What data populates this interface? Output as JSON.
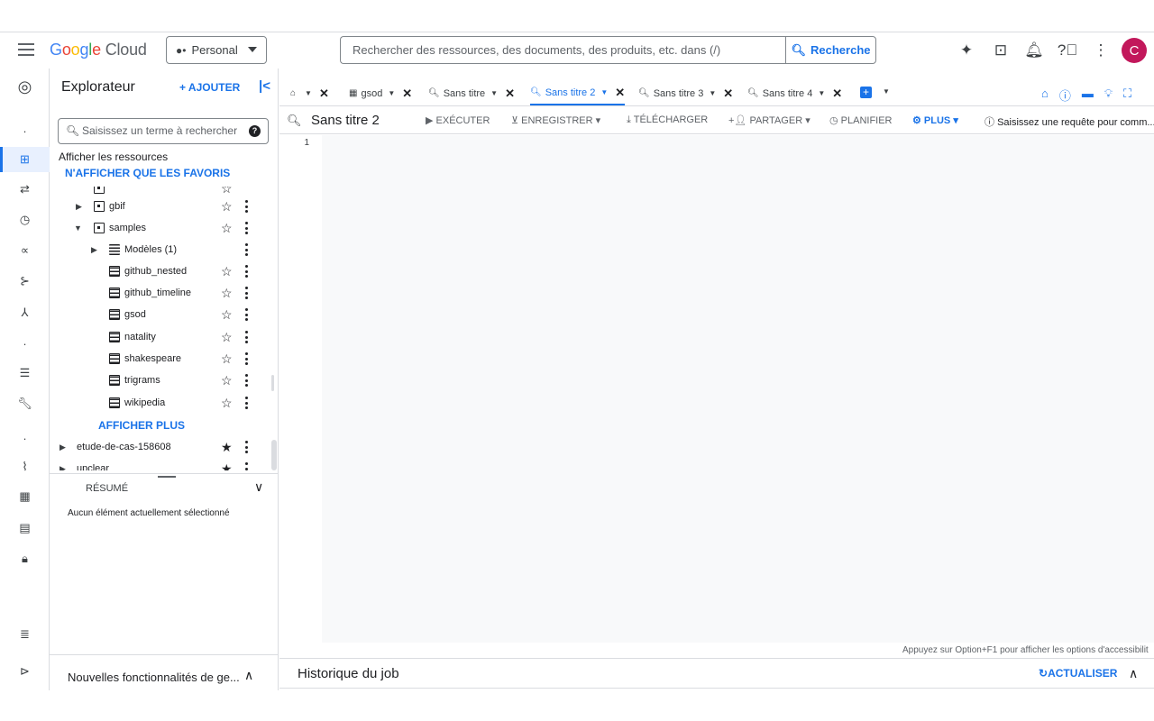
{
  "header": {
    "logo_google": [
      "G",
      "o",
      "o",
      "g",
      "l",
      "e"
    ],
    "logo_cloud": "Cloud",
    "project": "Personal",
    "search_placeholder": "Rechercher des ressources, des documents, des produits, etc. dans (/)",
    "search_button": "Recherche",
    "avatar_letter": "C",
    "icons": [
      "gemini-icon",
      "terminal-icon",
      "bell-icon",
      "help-icon",
      "more-vert-icon"
    ]
  },
  "explorer": {
    "title": "Explorateur",
    "add_label": "AJOUTER",
    "search_placeholder": "Saisissez un terme à rechercher",
    "show_resources": "Afficher les ressources",
    "favorites_only": "N'AFFICHER QUE LES FAVORIS",
    "tree": [
      {
        "label": "gbif",
        "kind": "dataset",
        "level": 1,
        "expanded": false,
        "starred": false
      },
      {
        "label": "samples",
        "kind": "dataset",
        "level": 1,
        "expanded": true,
        "starred": false
      },
      {
        "label": "Modèles (1)",
        "kind": "models",
        "level": 2,
        "expanded": false,
        "starred": null
      },
      {
        "label": "github_nested",
        "kind": "table",
        "level": 3,
        "starred": false
      },
      {
        "label": "github_timeline",
        "kind": "table",
        "level": 3,
        "starred": false
      },
      {
        "label": "gsod",
        "kind": "table",
        "level": 3,
        "starred": false
      },
      {
        "label": "natality",
        "kind": "table",
        "level": 3,
        "starred": false
      },
      {
        "label": "shakespeare",
        "kind": "table",
        "level": 3,
        "starred": false
      },
      {
        "label": "trigrams",
        "kind": "table",
        "level": 3,
        "starred": false
      },
      {
        "label": "wikipedia",
        "kind": "table",
        "level": 3,
        "starred": false
      }
    ],
    "show_more": "AFFICHER PLUS",
    "projects": [
      {
        "label": "etude-de-cas-158608",
        "starred": true
      },
      {
        "label": "upclear",
        "starred": true
      }
    ],
    "summary_label": "RÉSUMÉ",
    "no_selection": "Aucun élément actuellement sélectionné",
    "new_features": "Nouvelles fonctionnalités de ge..."
  },
  "tabs": [
    {
      "label": "",
      "icon": "home",
      "active": false
    },
    {
      "label": "gsod",
      "icon": "table",
      "active": false
    },
    {
      "label": "Sans titre",
      "icon": "query",
      "active": false
    },
    {
      "label": "Sans titre 2",
      "icon": "query",
      "active": true
    },
    {
      "label": "Sans titre 3",
      "icon": "query",
      "active": false
    },
    {
      "label": "Sans titre 4",
      "icon": "query",
      "active": false
    }
  ],
  "toolbar": {
    "title": "Sans titre 2",
    "run": "EXÉCUTER",
    "save": "ENREGISTRER",
    "download": "TÉLÉCHARGER",
    "share": "PARTAGER",
    "schedule": "PLANIFIER",
    "more": "PLUS",
    "info": "Saisissez une requête pour comm..."
  },
  "editor": {
    "line_number": "1",
    "a11y_hint": "Appuyez sur Option+F1 pour afficher les options d'accessibilit"
  },
  "jobs": {
    "title": "Historique du job",
    "refresh": "ACTUALISER"
  },
  "colors": {
    "accent": "#1a73e8",
    "avatar": "#c2185b"
  }
}
